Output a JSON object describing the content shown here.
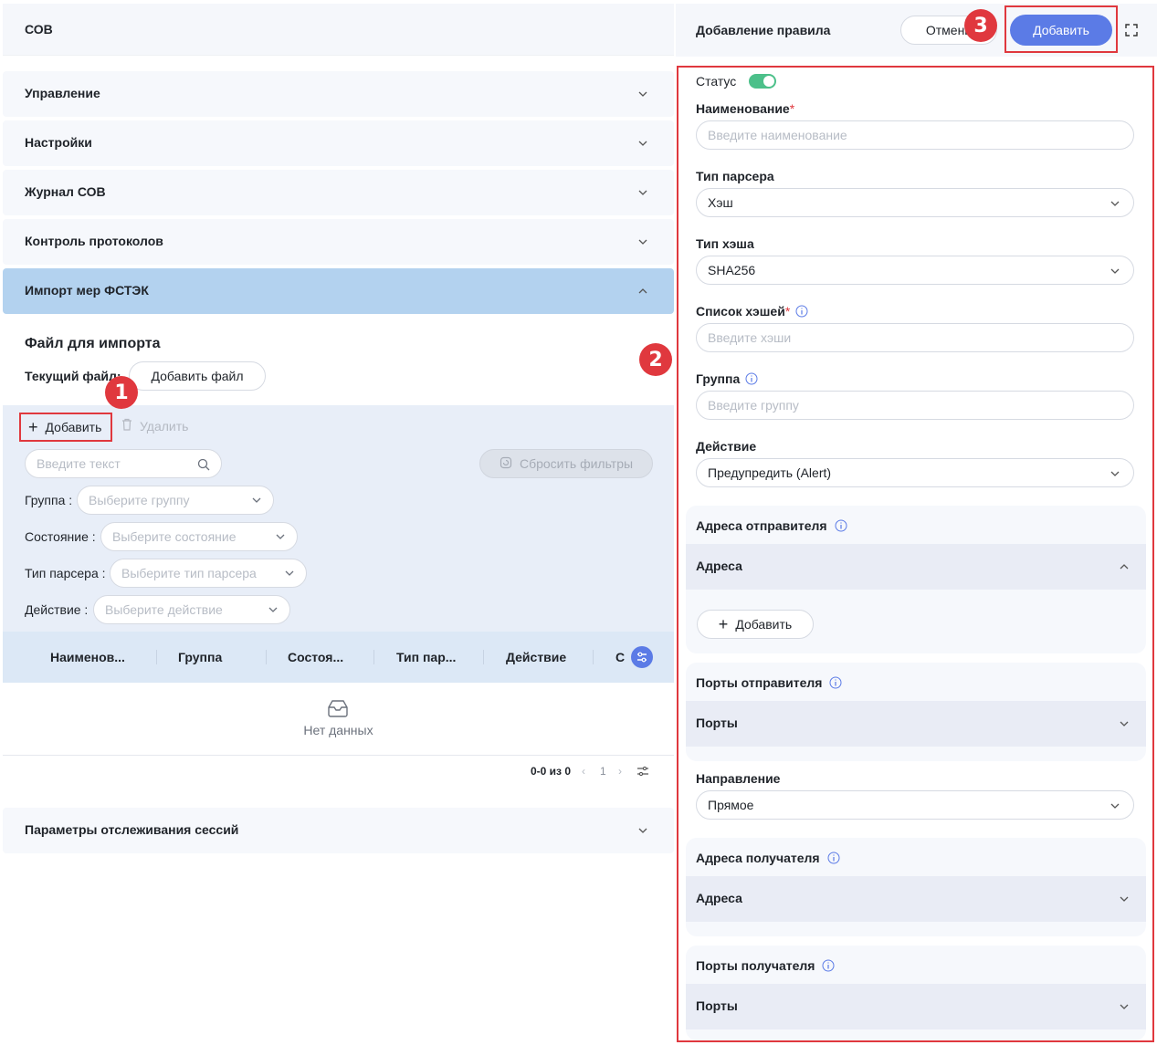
{
  "left": {
    "title": "СОВ",
    "accordions": [
      {
        "label": "Управление"
      },
      {
        "label": "Настройки"
      },
      {
        "label": "Журнал СОВ"
      },
      {
        "label": "Контроль протоколов"
      },
      {
        "label": "Импорт мер ФСТЭК"
      }
    ],
    "import": {
      "file_title": "Файл для импорта",
      "current_file_label": "Текущий файл:",
      "add_file_label": "Добавить файл",
      "add_label": "Добавить",
      "delete_label": "Удалить",
      "search_placeholder": "Введите текст",
      "reset_label": "Сбросить фильтры",
      "filters": [
        {
          "label": "Группа",
          "placeholder": "Выберите группу"
        },
        {
          "label": "Состояние",
          "placeholder": "Выберите состояние"
        },
        {
          "label": "Тип парсера",
          "placeholder": "Выберите тип парсера"
        },
        {
          "label": "Действие",
          "placeholder": "Выберите действие"
        }
      ],
      "columns": [
        "Наименов...",
        "Группа",
        "Состоя...",
        "Тип пар...",
        "Действие",
        "С"
      ],
      "empty_text": "Нет данных",
      "pager_range": "0-0 из 0",
      "pager_page": "1"
    },
    "sessions_label": "Параметры отслеживания сессий"
  },
  "right": {
    "title": "Добавление правила",
    "cancel_label": "Отмени",
    "add_label": "Добавить",
    "status_label": "Статус",
    "name_label": "Наименование",
    "name_placeholder": "Введите наименование",
    "parser_type_label": "Тип парсера",
    "parser_type_value": "Хэш",
    "hash_type_label": "Тип хэша",
    "hash_type_value": "SHA256",
    "hash_list_label": "Список хэшей",
    "hash_list_placeholder": "Введите хэши",
    "group_label": "Группа",
    "group_placeholder": "Введите группу",
    "action_label": "Действие",
    "action_value": "Предупредить (Alert)",
    "sender_addresses_label": "Адреса отправителя",
    "addresses_label": "Адреса",
    "add_address_label": "Добавить",
    "sender_ports_label": "Порты отправителя",
    "ports_label": "Порты",
    "direction_label": "Направление",
    "direction_value": "Прямое",
    "receiver_addresses_label": "Адреса получателя",
    "receiver_ports_label": "Порты получателя"
  },
  "markers": [
    "1",
    "2",
    "3"
  ],
  "colors": {
    "accent": "#5b7be6",
    "highlight": "#e0383e",
    "toggle_on": "#4cc08a",
    "open_accordion": "#b3d2ef"
  }
}
